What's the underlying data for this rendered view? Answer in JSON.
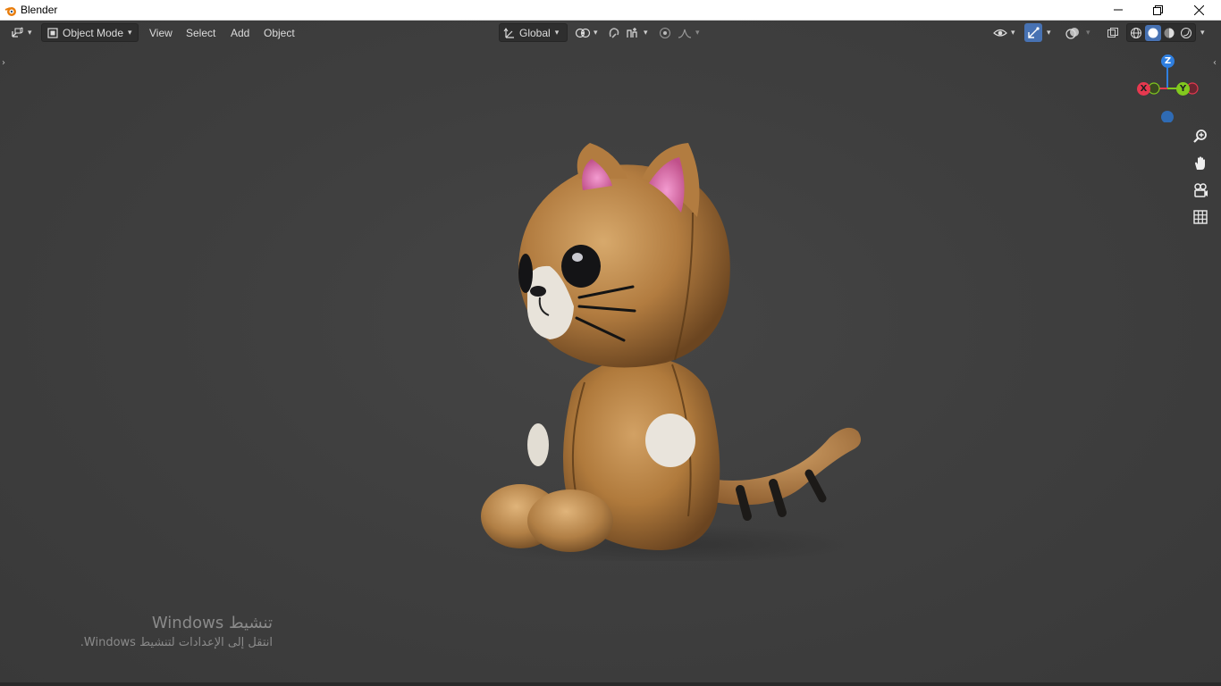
{
  "window": {
    "title": "Blender",
    "logo_icon": "blender-logo-icon",
    "controls": [
      "minimize-icon",
      "restore-icon",
      "close-icon"
    ]
  },
  "header": {
    "editor_type_icon": "3d-viewport-icon",
    "mode": {
      "icon": "object-mode-icon",
      "label": "Object Mode"
    },
    "menus": [
      "View",
      "Select",
      "Add",
      "Object"
    ],
    "transform_orientation": {
      "icon": "orientation-icon",
      "label": "Global"
    },
    "pivot_icon": "pivot-point-icon",
    "snap_icon": "snap-magnet-icon",
    "snap_target_icon": "snap-increment-icon",
    "proportional_icon": "proportional-edit-icon",
    "falloff_icon": "falloff-curve-icon",
    "visibility_icon": "eye-icon",
    "gizmo_toggle_icon": "gizmo-icon",
    "overlay_icon": "overlay-icon",
    "xray_icon": "xray-icon",
    "shading_modes": [
      "wireframe-shading-icon",
      "solid-shading-icon",
      "material-preview-icon",
      "rendered-shading-icon"
    ]
  },
  "gizmo": {
    "axes": {
      "x": "X",
      "y": "Y",
      "z": "Z"
    },
    "colors": {
      "x": "#e6384f",
      "y": "#82c91e",
      "z": "#2f7fe0"
    }
  },
  "nav_tools": [
    "zoom-icon",
    "pan-hand-icon",
    "camera-view-icon",
    "ortho-grid-icon"
  ],
  "watermark": {
    "line1": "تنشيط Windows",
    "line2": "انتقل إلى الإعدادات لتنشيط Windows."
  },
  "colors": {
    "viewport_bg": "#3d3d3d",
    "accent": "#4772b3",
    "cat_fur": "#b07a3c"
  }
}
